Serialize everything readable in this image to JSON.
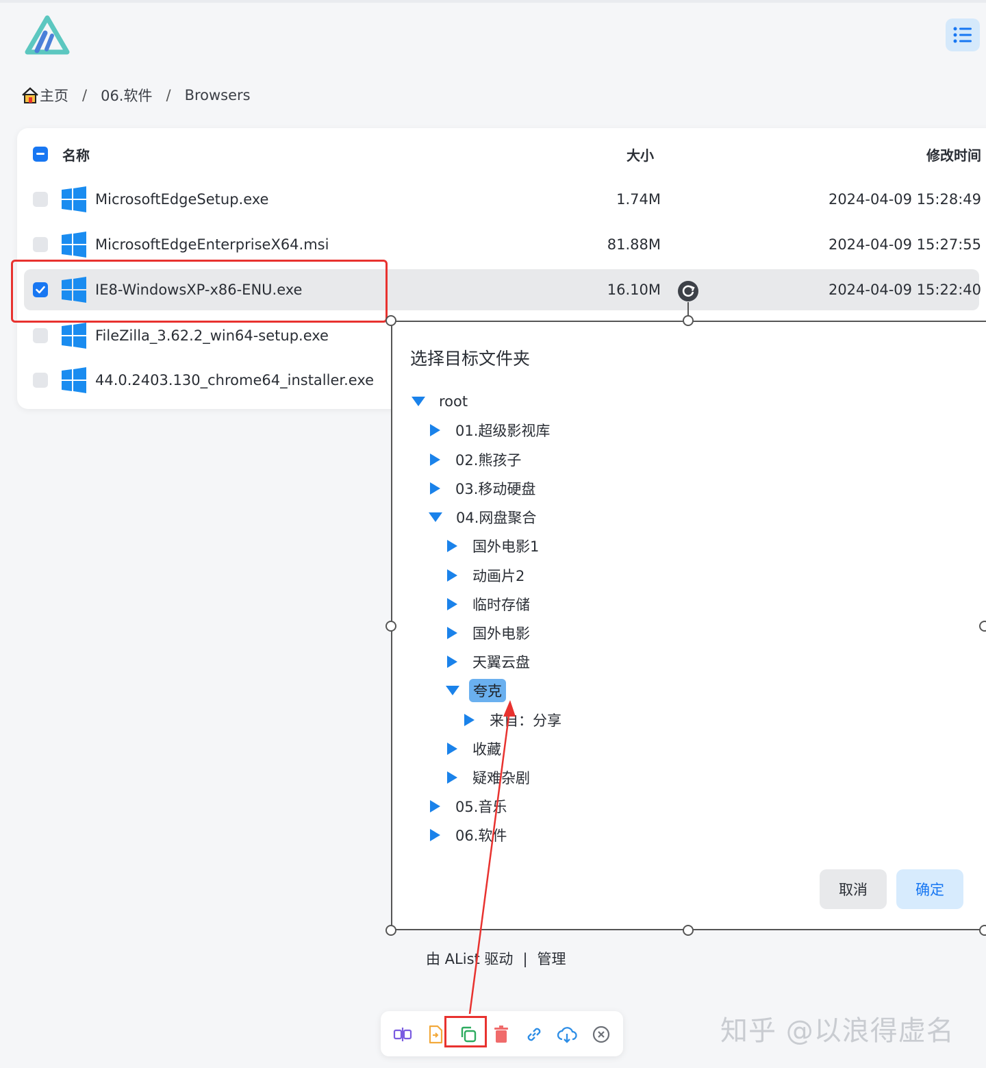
{
  "breadcrumb": {
    "home": "主页",
    "sep": "/",
    "items": [
      "06.软件",
      "Browsers"
    ]
  },
  "list": {
    "header": {
      "name": "名称",
      "size": "大小",
      "time": "修改时间"
    },
    "rows": [
      {
        "name": "MicrosoftEdgeSetup.exe",
        "size": "1.74M",
        "time": "2024-04-09 15:28:49",
        "checked": false
      },
      {
        "name": "MicrosoftEdgeEnterpriseX64.msi",
        "size": "81.88M",
        "time": "2024-04-09 15:27:55",
        "checked": false
      },
      {
        "name": "IE8-WindowsXP-x86-ENU.exe",
        "size": "16.10M",
        "time": "2024-04-09 15:22:40",
        "checked": true
      },
      {
        "name": "FileZilla_3.62.2_win64-setup.exe",
        "size": "",
        "time": "",
        "checked": false
      },
      {
        "name": "44.0.2403.130_chrome64_installer.exe",
        "size": "",
        "time": "",
        "checked": false
      }
    ]
  },
  "dialog": {
    "title": "选择目标文件夹",
    "tree": [
      {
        "label": "root",
        "expanded": true
      },
      {
        "label": "01.超级影视库",
        "expanded": false
      },
      {
        "label": "02.熊孩子",
        "expanded": false
      },
      {
        "label": "03.移动硬盘",
        "expanded": false
      },
      {
        "label": "04.网盘聚合",
        "expanded": true
      },
      {
        "label": "国外电影1",
        "expanded": false
      },
      {
        "label": "动画片2",
        "expanded": false
      },
      {
        "label": "临时存储",
        "expanded": false
      },
      {
        "label": "国外电影",
        "expanded": false
      },
      {
        "label": "天翼云盘",
        "expanded": false
      },
      {
        "label": "夸克",
        "expanded": true,
        "selected": true
      },
      {
        "label": "来自：分享",
        "expanded": false
      },
      {
        "label": "收藏",
        "expanded": false
      },
      {
        "label": "疑难杂剧",
        "expanded": false
      },
      {
        "label": "05.音乐",
        "expanded": false
      },
      {
        "label": "06.软件",
        "expanded": false
      }
    ],
    "cancel": "取消",
    "ok": "确定"
  },
  "footer": {
    "powered": "由 AList 驱动",
    "divider": "|",
    "manage": "管理"
  },
  "toolbar": {
    "icons": [
      "rename-icon",
      "move-icon",
      "copy-icon",
      "delete-icon",
      "link-icon",
      "download-icon",
      "close-icon"
    ]
  },
  "watermark": "知乎 @以浪得虚名",
  "colors": {
    "accent": "#1877f2",
    "highlight": "#e8322f",
    "selected_node": "#6ab0ef"
  }
}
